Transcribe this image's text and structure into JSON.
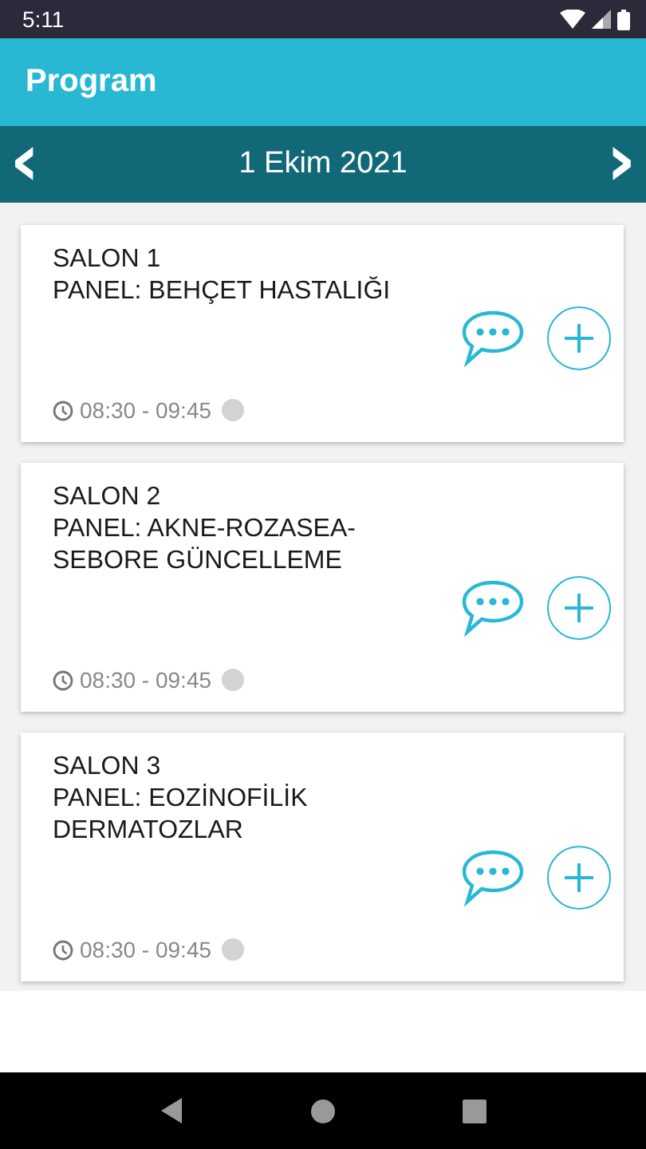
{
  "status_bar": {
    "time": "5:11"
  },
  "app_bar": {
    "title": "Program"
  },
  "date_bar": {
    "prev": "‹",
    "date": "1 Ekim 2021",
    "next": "›"
  },
  "sessions": [
    {
      "hall": "SALON 1",
      "title": "PANEL: BEHÇET HASTALIĞI",
      "time": "08:30 - 09:45",
      "color": "#d3d3d3"
    },
    {
      "hall": "SALON 2",
      "title": "PANEL: AKNE-ROZASEA-SEBORE GÜNCELLEME",
      "time": "08:30 - 09:45",
      "color": "#d3d3d3"
    },
    {
      "hall": "SALON 3",
      "title": "PANEL: EOZİNOFİLİK DERMATOZLAR",
      "time": "08:30 - 09:45",
      "color": "#d3d3d3"
    }
  ]
}
